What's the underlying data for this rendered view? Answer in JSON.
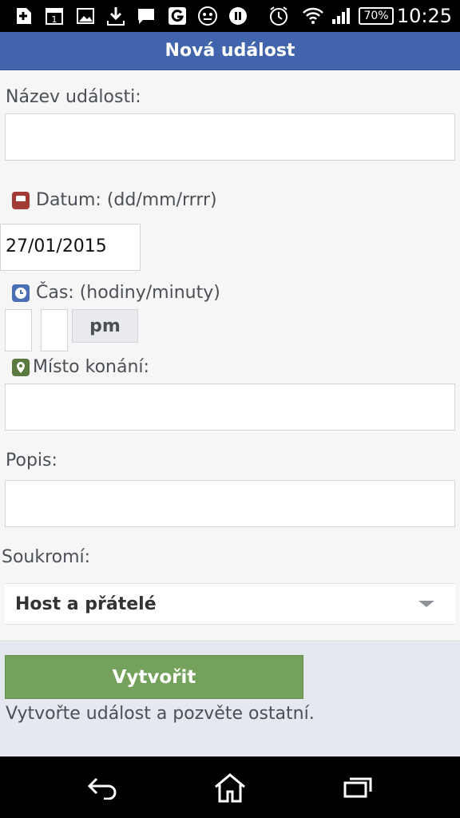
{
  "status_bar": {
    "battery": "70%",
    "time": "10:25",
    "calendar_day": "1",
    "icons": [
      "add-icon",
      "calendar-icon",
      "image-icon",
      "download-icon",
      "chat-icon",
      "g-icon",
      "robot-icon",
      "media-icon",
      "alarm-icon",
      "wifi-icon",
      "signal-icon",
      "battery-icon"
    ]
  },
  "header": {
    "title": "Nová událost"
  },
  "form": {
    "name_label": "Název události:",
    "name_value": "",
    "date_label": "Datum: (dd/mm/rrrr)",
    "date_value": "27/01/2015",
    "time_label": "Čas: (hodiny/minuty)",
    "hours_value": "",
    "minutes_value": "",
    "ampm_label": "pm",
    "location_label": "Místo konání:",
    "location_value": "",
    "description_label": "Popis:",
    "description_value": "",
    "privacy_label": "Soukromí:",
    "privacy_value": "Host a přátelé"
  },
  "actions": {
    "create_label": "Vytvořit",
    "hint": "Vytvořte událost a pozvěte ostatní."
  },
  "nav": {
    "icons": [
      "back-icon",
      "home-icon",
      "recent-apps-icon"
    ]
  },
  "colors": {
    "header": "#4264ac",
    "create_button": "#74a15b",
    "date_icon": "#a23b35",
    "time_icon": "#4a6fb5",
    "location_icon": "#5b7a3f"
  }
}
